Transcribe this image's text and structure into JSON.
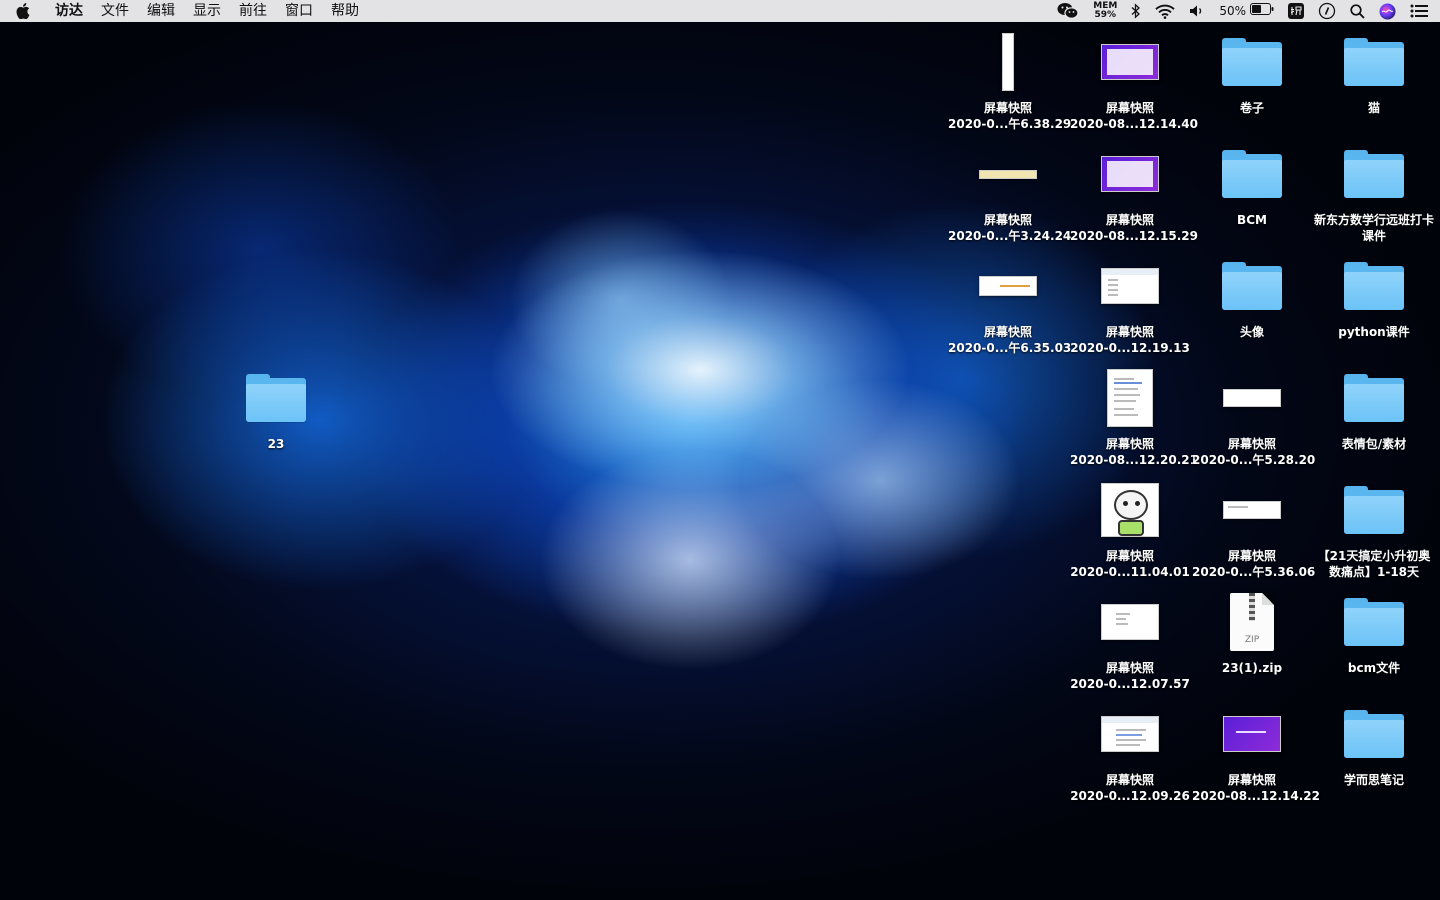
{
  "menubar": {
    "apple": "",
    "items": [
      "访达",
      "文件",
      "编辑",
      "显示",
      "前往",
      "窗口",
      "帮助"
    ],
    "status": {
      "mem_label": "MEM",
      "mem_value": "59%",
      "battery": "50%"
    }
  },
  "desktop": {
    "icons": [
      {
        "id": "ss1",
        "line1": "屏幕快照",
        "line2": "2020-0...午6.38.29"
      },
      {
        "id": "ss2",
        "line1": "屏幕快照",
        "line2": "2020-08...12.14.40"
      },
      {
        "id": "f_juanzi",
        "line1": "卷子"
      },
      {
        "id": "f_mao",
        "line1": "猫"
      },
      {
        "id": "ss3",
        "line1": "屏幕快照",
        "line2": "2020-0...午3.24.24"
      },
      {
        "id": "ss4",
        "line1": "屏幕快照",
        "line2": "2020-08...12.15.29"
      },
      {
        "id": "f_bcm",
        "line1": "BCM"
      },
      {
        "id": "f_xdf",
        "line1": "新东方数学行远班打卡课件"
      },
      {
        "id": "ss5",
        "line1": "屏幕快照",
        "line2": "2020-0...午6.35.03"
      },
      {
        "id": "ss6",
        "line1": "屏幕快照",
        "line2": "2020-0...12.19.13"
      },
      {
        "id": "f_touxiang",
        "line1": "头像"
      },
      {
        "id": "f_python",
        "line1": "python课件"
      },
      {
        "id": "ss7",
        "line1": "屏幕快照",
        "line2": "2020-08...12.20.21"
      },
      {
        "id": "ss8",
        "line1": "屏幕快照",
        "line2": "2020-0...午5.28.20"
      },
      {
        "id": "f_biaoqing",
        "line1": "表情包/素材"
      },
      {
        "id": "ss9",
        "line1": "屏幕快照",
        "line2": "2020-0...11.04.01"
      },
      {
        "id": "ss10",
        "line1": "屏幕快照",
        "line2": "2020-0...午5.36.06"
      },
      {
        "id": "f_21",
        "line1": "【21天搞定小升初奥数痛点】1-18天"
      },
      {
        "id": "ss11",
        "line1": "屏幕快照",
        "line2": "2020-0...12.07.57"
      },
      {
        "id": "zip",
        "line1": "23(1).zip",
        "badge": "ZIP"
      },
      {
        "id": "f_bcmfile",
        "line1": "bcm文件"
      },
      {
        "id": "ss12",
        "line1": "屏幕快照",
        "line2": "2020-0...12.09.26"
      },
      {
        "id": "ss13",
        "line1": "屏幕快照",
        "line2": "2020-08...12.14.22"
      },
      {
        "id": "f_xueersi",
        "line1": "学而思笔记"
      },
      {
        "id": "f_23",
        "line1": "23"
      }
    ]
  }
}
